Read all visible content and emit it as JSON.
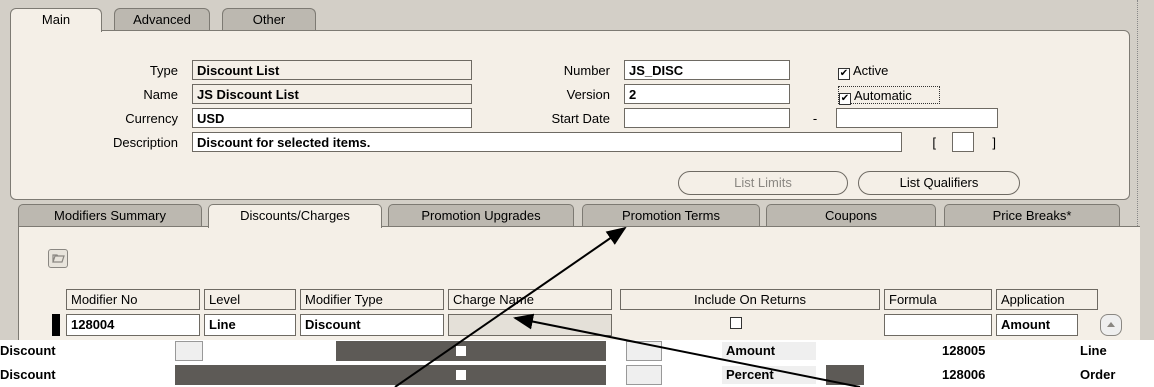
{
  "top_tabs": [
    "Main",
    "Advanced",
    "Other"
  ],
  "form": {
    "type_label": "Type",
    "type_value": "Discount List",
    "name_label": "Name",
    "name_value": "JS Discount List",
    "currency_label": "Currency",
    "currency_value": "USD",
    "description_label": "Description",
    "description_value": "Discount for selected items.",
    "number_label": "Number",
    "number_value": "JS_DISC",
    "version_label": "Version",
    "version_value": "2",
    "start_date_label": "Start Date",
    "start_date_value": "",
    "date_separator": "-",
    "end_date_value": "",
    "active_label": "Active",
    "active_checked": true,
    "automatic_label": "Automatic",
    "automatic_checked": true,
    "bracket_open": "[",
    "bracket_close": "]"
  },
  "buttons": {
    "list_limits": "List Limits",
    "list_qualifiers": "List Qualifiers"
  },
  "lower_tabs": [
    "Modifiers Summary",
    "Discounts/Charges",
    "Promotion Upgrades",
    "Promotion Terms",
    "Coupons",
    "Price Breaks*"
  ],
  "table": {
    "headers": [
      "Modifier No",
      "Level",
      "Modifier Type",
      "Charge Name",
      "Include On Returns",
      "Formula",
      "Application"
    ],
    "row": {
      "modifier_no": "128004",
      "level": "Line",
      "modifier_type": "Discount",
      "charge_name": "",
      "include_on_returns": false,
      "formula": "",
      "application": "Amount"
    }
  },
  "garbled_rows": [
    {
      "type": "Discount",
      "application": "Amount",
      "modifier_no": "128005",
      "level": "Line"
    },
    {
      "type": "Discount",
      "application": "Percent",
      "modifier_no": "128006",
      "level": "Order"
    }
  ],
  "icons": {
    "folder": "folder-icon",
    "scroll_up": "scroll-up-icon",
    "check": "✔"
  }
}
